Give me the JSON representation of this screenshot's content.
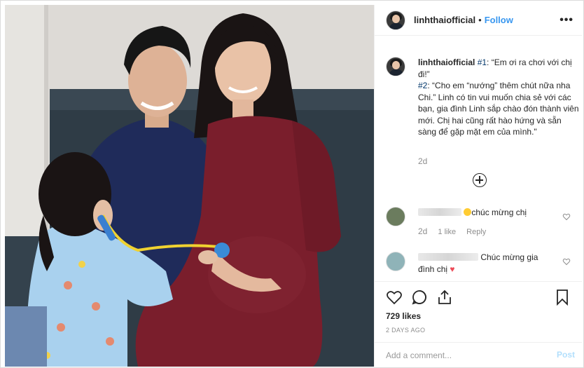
{
  "post": {
    "username": "linhthaiofficial",
    "separator": "•",
    "follow_label": "Follow",
    "more_icon": "more-options-icon",
    "more_label": "•••"
  },
  "caption": {
    "username": "linhthaiofficial",
    "tag1": "#1",
    "text1": ": “Em ơi ra chơi với chị đi!”",
    "tag2": "#2",
    "text2": ": “Cho em “nướng” thêm chút nữa nha Chi.” Linh có tin vui muốn chia sẻ với các bạn, gia đình Linh sắp chào đón thành viên mới. Chị hai cũng rất hào hứng và sẵn sàng để gặp mặt em của mình.\"",
    "time": "2d"
  },
  "comments": [
    {
      "text": "chúc mừng chị",
      "time": "2d",
      "likes": "1 like",
      "reply": "Reply"
    },
    {
      "text": "Chúc mừng gia đình chị",
      "heart": "♥"
    }
  ],
  "actions": {
    "likes": "729 likes",
    "date": "2 DAYS AGO",
    "add_comment_placeholder": "Add a comment...",
    "post_label": "Post"
  },
  "colors": {
    "accent": "#3897f0",
    "post_disabled": "#b2dffc",
    "hashtag": "#003569"
  }
}
